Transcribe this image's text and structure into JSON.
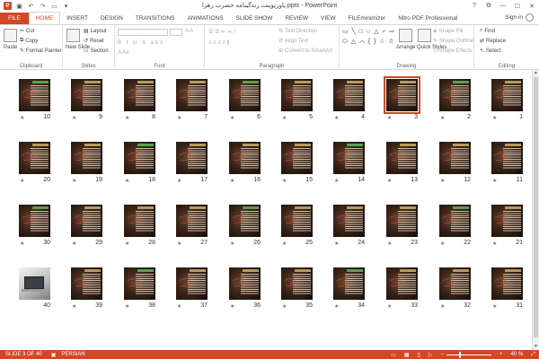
{
  "window": {
    "title": "پاورپوینت زندگینامه حضرت زهرا.pptx - PowerPoint",
    "controls": [
      "?",
      "⧉",
      "—",
      "☐",
      "✕"
    ]
  },
  "tabs": [
    {
      "label": "FILE"
    },
    {
      "label": "HOME"
    },
    {
      "label": "INSERT"
    },
    {
      "label": "DESIGN"
    },
    {
      "label": "TRANSITIONS"
    },
    {
      "label": "ANIMATIONS"
    },
    {
      "label": "SLIDE SHOW"
    },
    {
      "label": "REVIEW"
    },
    {
      "label": "VIEW"
    },
    {
      "label": "FILEminimizer"
    },
    {
      "label": "Nitro PDF Professional"
    }
  ],
  "signin": "Sign in",
  "ribbon": {
    "clipboard": {
      "paste": "Paste",
      "cut": "Cut",
      "copy": "Copy",
      "format_painter": "Format Painter",
      "label": "Clipboard"
    },
    "slides": {
      "new_slide": "New Slide",
      "layout": "Layout",
      "reset": "Reset",
      "section": "Section",
      "label": "Slides"
    },
    "font": {
      "label": "Font"
    },
    "paragraph": {
      "text_direction": "Text Direction",
      "align_text": "Align Text",
      "convert_smartart": "Convert to SmartArt",
      "label": "Paragraph"
    },
    "drawing": {
      "arrange": "Arrange",
      "quick_styles": "Quick Styles",
      "shape_fill": "Shape Fill",
      "shape_outline": "Shape Outline",
      "shape_effects": "Shape Effects",
      "label": "Drawing"
    },
    "editing": {
      "find": "Find",
      "replace": "Replace",
      "select": "Select",
      "label": "Editing"
    }
  },
  "slides": [
    {
      "n": "1",
      "star": "★",
      "style": "dark"
    },
    {
      "n": "2",
      "star": "★",
      "style": "dark"
    },
    {
      "n": "3",
      "star": "★",
      "style": "dark",
      "selected": true
    },
    {
      "n": "4",
      "star": "★",
      "style": "dark"
    },
    {
      "n": "5",
      "star": "★",
      "style": "dark"
    },
    {
      "n": "6",
      "star": "★",
      "style": "dark"
    },
    {
      "n": "7",
      "star": "★",
      "style": "dark"
    },
    {
      "n": "8",
      "star": "★",
      "style": "dark"
    },
    {
      "n": "9",
      "star": "★",
      "style": "dark"
    },
    {
      "n": "10",
      "star": "★",
      "style": "dark"
    },
    {
      "n": "11",
      "star": "★",
      "style": "dark"
    },
    {
      "n": "12",
      "star": "★",
      "style": "dark"
    },
    {
      "n": "13",
      "star": "★",
      "style": "dark"
    },
    {
      "n": "14",
      "star": "★",
      "style": "dark"
    },
    {
      "n": "15",
      "star": "★",
      "style": "dark"
    },
    {
      "n": "16",
      "star": "★",
      "style": "dark"
    },
    {
      "n": "17",
      "star": "★",
      "style": "dark"
    },
    {
      "n": "18",
      "star": "★",
      "style": "dark"
    },
    {
      "n": "19",
      "star": "★",
      "style": "dark"
    },
    {
      "n": "20",
      "star": "★",
      "style": "dark"
    },
    {
      "n": "21",
      "star": "★",
      "style": "dark"
    },
    {
      "n": "22",
      "star": "★",
      "style": "dark"
    },
    {
      "n": "23",
      "star": "★",
      "style": "dark"
    },
    {
      "n": "24",
      "star": "★",
      "style": "dark"
    },
    {
      "n": "25",
      "star": "★",
      "style": "dark"
    },
    {
      "n": "26",
      "star": "★",
      "style": "dark"
    },
    {
      "n": "27",
      "star": "★",
      "style": "dark"
    },
    {
      "n": "28",
      "star": "★",
      "style": "dark"
    },
    {
      "n": "29",
      "star": "★",
      "style": "dark"
    },
    {
      "n": "30",
      "star": "★",
      "style": "dark"
    },
    {
      "n": "31",
      "star": "★",
      "style": "dark"
    },
    {
      "n": "32",
      "star": "★",
      "style": "dark"
    },
    {
      "n": "33",
      "star": "★",
      "style": "dark"
    },
    {
      "n": "34",
      "star": "★",
      "style": "dark"
    },
    {
      "n": "35",
      "star": "★",
      "style": "dark"
    },
    {
      "n": "36",
      "star": "★",
      "style": "dark"
    },
    {
      "n": "37",
      "star": "★",
      "style": "dark"
    },
    {
      "n": "38",
      "star": "★",
      "style": "dark"
    },
    {
      "n": "39",
      "star": "★",
      "style": "dark"
    },
    {
      "n": "40",
      "star": "",
      "style": "light"
    }
  ],
  "status": {
    "slide_info": "SLIDE 3 OF 40",
    "language": "PERSIAN",
    "zoom": "40 %"
  },
  "colors": {
    "accent": "#d24726"
  }
}
